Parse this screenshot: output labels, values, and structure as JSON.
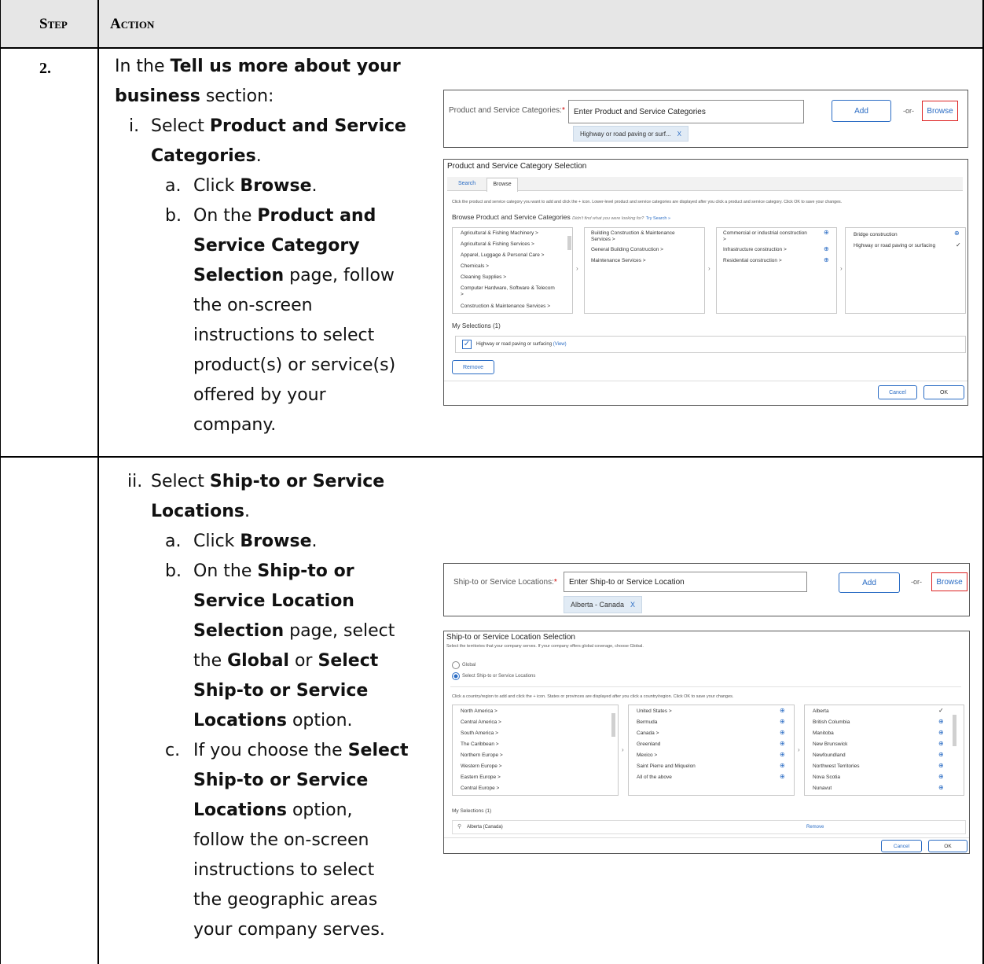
{
  "header": {
    "step": "Step",
    "action": "Action"
  },
  "row1": {
    "step_number": "2.",
    "intro_a": "In the ",
    "intro_b": "Tell us more about your",
    "intro_c": "business",
    "intro_d": " section:",
    "i_num": "i.",
    "i_a": "Select ",
    "i_b": "Product and Service",
    "i_c": "Categories",
    "i_d": ".",
    "a_num": "a.",
    "a_a": "Click ",
    "a_b": "Browse",
    "a_c": ".",
    "b_num": "b.",
    "b_a": "On the ",
    "b_b": "Product and",
    "b_c": "Service Category",
    "b_d": "Selection",
    "b_e": " page, follow",
    "b_f": "the on-screen",
    "b_g": "instructions to select",
    "b_h": "product(s) or service(s)",
    "b_i": "offered by your",
    "b_j": "company."
  },
  "row2": {
    "ii_num": "ii.",
    "ii_a": "Select ",
    "ii_b": "Ship-to or Service",
    "ii_c": "Locations",
    "ii_d": ".",
    "a_num": "a.",
    "a_a": "Click ",
    "a_b": "Browse",
    "a_c": ".",
    "b_num": "b.",
    "b_a": "On the ",
    "b_b": "Ship-to or",
    "b_c": "Service Location",
    "b_d": "Selection",
    "b_e": " page, select",
    "b_f": "the ",
    "b_g": "Global",
    "b_h": " or ",
    "b_i": "Select",
    "b_j": "Ship-to or Service",
    "b_k": "Locations",
    "b_l": " option.",
    "c_num": "c.",
    "c_a": "If you choose the ",
    "c_b": "Select",
    "c_c": "Ship-to or Service",
    "c_d": "Locations",
    "c_e": " option,",
    "c_f": "follow the on-screen",
    "c_g": "instructions to select",
    "c_h": "the geographic areas",
    "c_i": "your company serves."
  },
  "shot1": {
    "label": "Product and Service Categories:",
    "required": "*",
    "placeholder": "Enter Product and Service Categories",
    "add": "Add",
    "or": "-or-",
    "browse": "Browse",
    "tag": "Highway or road paving or surf...",
    "tag_x": "X"
  },
  "shot2": {
    "title": "Product and Service Category Selection",
    "tab_search": "Search",
    "tab_browse": "Browse",
    "instructions": "Click the product and service category you want to add and click the + icon. Lower-level product and service categories are displayed after you click a product and service category. Click OK to save your changes.",
    "browse_title": "Browse Product and Service Categories",
    "didnt_find": "Didn't find what you were looking for?",
    "try_search": "Try Search »",
    "col1": [
      "Agricultural & Fishing Machinery  >",
      "Agricultural & Fishing Services  >",
      "Apparel, Luggage & Personal Care  >",
      "Chemicals  >",
      "Cleaning Supplies  >",
      "Computer Hardware, Software & Telecom",
      "  >",
      "Construction & Maintenance Services  >"
    ],
    "col2": [
      "Building Construction & Maintenance",
      "Services  >",
      "General Building Construction  >",
      "Maintenance Services  >"
    ],
    "col3": [
      "Commercial or industrial construction",
      "  >",
      "Infrastructure construction  >",
      "Residential construction  >"
    ],
    "col4": [
      "Bridge construction",
      "Highway or road paving or surfacing"
    ],
    "my_selections": "My Selections (1)",
    "selected": "Highway or road paving or surfacing",
    "view": "(View)",
    "remove": "Remove",
    "cancel": "Cancel",
    "ok": "OK"
  },
  "shot3": {
    "label": "Ship-to or Service Locations:",
    "required": "*",
    "placeholder": "Enter Ship-to or Service Location",
    "add": "Add",
    "or": "-or-",
    "browse": "Browse",
    "tag": "Alberta - Canada",
    "tag_x": "X"
  },
  "shot4": {
    "title": "Ship-to or Service Location Selection",
    "subtitle": "Select the territories that your company serves. If your company offers global coverage, choose Global.",
    "opt_global": "Global",
    "opt_select": "Select Ship-to or Service Locations",
    "instructions": "Click a country/region to add and click the + icon. States or provinces are displayed after you click a country/region. Click OK to save your changes.",
    "col1": [
      "North America  >",
      "Central America  >",
      "South America  >",
      "The Caribbean  >",
      "Northern Europe  >",
      "Western Europe  >",
      "Eastern Europe  >",
      "Central Europe  >"
    ],
    "col2": [
      "United States  >",
      "Bermuda",
      "Canada  >",
      "Greenland",
      "Mexico  >",
      "Saint Pierre and Miquelon",
      "All of the above"
    ],
    "col3": [
      "Alberta",
      "British Columbia",
      "Manitoba",
      "New Brunswick",
      "Newfoundland",
      "Northwest Territories",
      "Nova Scotia",
      "Nunavut"
    ],
    "my_selections": "My Selections (1)",
    "selected": "Alberta (Canada)",
    "remove": "Remove",
    "cancel": "Cancel",
    "ok": "OK"
  }
}
